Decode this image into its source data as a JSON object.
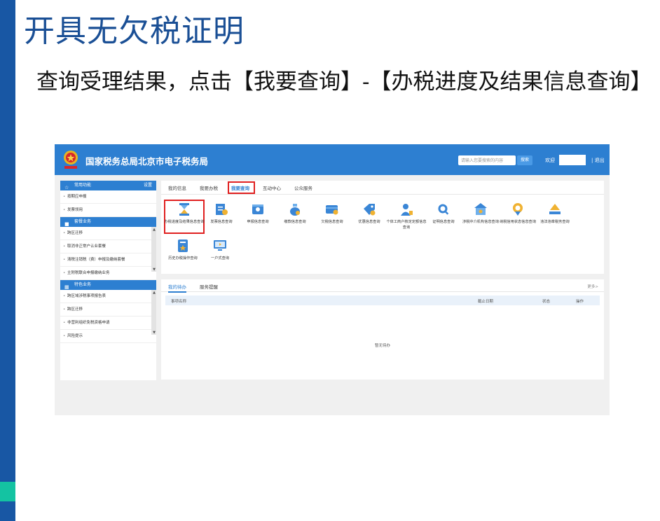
{
  "slide": {
    "title": "开具无欠税证明",
    "body": "查询受理结果，点击【我要查询】-【办税进度及结果信息查询】"
  },
  "header": {
    "site_title": "国家税务总局北京市电子税务局",
    "search_placeholder": "请输入您要搜索的内容",
    "search_button": "搜索",
    "welcome": "欢迎",
    "logout": "| 退出"
  },
  "sidebar": {
    "sections": [
      {
        "title": "常用功能",
        "extra": "设置",
        "icon": "star-icon",
        "items": [
          "按期应申报",
          "发票领用"
        ]
      },
      {
        "title": "套餐业务",
        "extra": "",
        "icon": "package-icon",
        "items": [
          "跨区迁移",
          "取消非正常户认业套餐",
          "清税注销税（费）申报及缴纳套餐",
          "主附税联合申报缴纳业务"
        ]
      },
      {
        "title": "特色业务",
        "extra": "",
        "icon": "grid-icon",
        "items": [
          "跨区域涉税事项报告表",
          "跨区迁移",
          "非营利组织免税资格申请",
          "风险提示"
        ]
      }
    ]
  },
  "tabs": [
    {
      "label": "我的信息",
      "active": false
    },
    {
      "label": "我要办税",
      "active": false
    },
    {
      "label": "我要查询",
      "active": true
    },
    {
      "label": "互动中心",
      "active": false
    },
    {
      "label": "公众服务",
      "active": false
    }
  ],
  "tiles": [
    {
      "label": "办税进度及结果信息查询",
      "icon": "hourglass-icon"
    },
    {
      "label": "发票信息查询",
      "icon": "invoice-icon"
    },
    {
      "label": "申报信息查询",
      "icon": "declaration-icon"
    },
    {
      "label": "缴款信息查询",
      "icon": "money-bag-icon"
    },
    {
      "label": "欠税信息查询",
      "icon": "arrears-icon"
    },
    {
      "label": "优惠信息查询",
      "icon": "discount-icon"
    },
    {
      "label": "个体工商户核定定额信息查询",
      "icon": "person-icon"
    },
    {
      "label": "证明信息查询",
      "icon": "certificate-icon"
    },
    {
      "label": "涉税中介机构信息查询",
      "icon": "agency-icon"
    },
    {
      "label": "纳税信用状态信息查询",
      "icon": "credit-medal-icon"
    },
    {
      "label": "违法违章税务查询",
      "icon": "gavel-icon"
    },
    {
      "label": "历史办税操作查询",
      "icon": "history-icon"
    },
    {
      "label": "一户式查询",
      "icon": "monitor-icon"
    }
  ],
  "todo": {
    "tabs": [
      "我的待办",
      "服务提醒"
    ],
    "more": "更多>",
    "columns": [
      "事项名称",
      "截止日期",
      "状态",
      "操作"
    ],
    "empty": "暂无待办"
  },
  "colors": {
    "brand_blue": "#2d7fd1",
    "slide_blue": "#1857a4",
    "highlight_red": "#e02020",
    "accent_teal": "#14c3a2"
  }
}
